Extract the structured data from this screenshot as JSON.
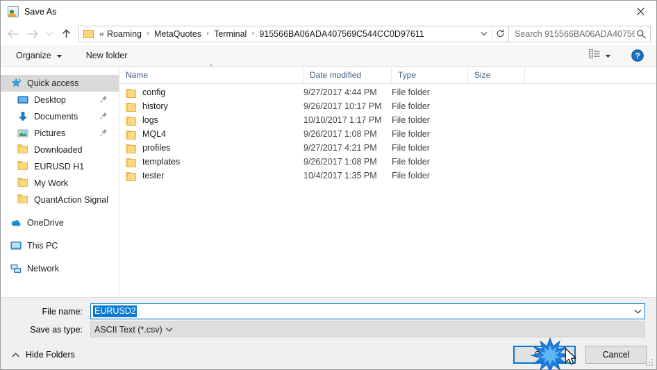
{
  "window": {
    "title": "Save As",
    "icon": "save-as-app-icon",
    "close_label": "✕"
  },
  "nav": {
    "back": "back-arrow",
    "forward": "forward-arrow",
    "recent": "recent-locations-chevron",
    "up": "up-arrow",
    "back_enabled": false,
    "forward_enabled": false,
    "up_enabled": true
  },
  "address": {
    "folder_icon": "folder-icon",
    "prefix": "«",
    "crumbs": [
      "Roaming",
      "MetaQuotes",
      "Terminal",
      "915566BA06ADA407569C544CC0D97611"
    ],
    "separator": "›",
    "dropdown_icon": "chevron-down-icon",
    "refresh_icon": "refresh-icon"
  },
  "search": {
    "placeholder": "Search 915566BA06ADA40756...",
    "value": "",
    "icon": "search-icon"
  },
  "toolbar": {
    "organize_label": "Organize",
    "organize_caret": "▾",
    "new_folder_label": "New folder",
    "view_icon": "list-view-icon",
    "view_caret": "▾",
    "help_icon": "help-icon",
    "help_label": "?"
  },
  "sidebar": {
    "items": [
      {
        "label": "Quick access",
        "icon": "star-pin-icon",
        "level": "top",
        "selected": true,
        "pinned": false
      },
      {
        "label": "Desktop",
        "icon": "desktop-icon",
        "level": "lvl0",
        "selected": false,
        "pinned": true
      },
      {
        "label": "Documents",
        "icon": "documents-icon",
        "level": "lvl0",
        "selected": false,
        "pinned": true
      },
      {
        "label": "Pictures",
        "icon": "pictures-icon",
        "level": "lvl0",
        "selected": false,
        "pinned": true
      },
      {
        "label": "Downloaded",
        "icon": "folder-icon",
        "level": "lvl0",
        "selected": false,
        "pinned": false
      },
      {
        "label": "EURUSD H1",
        "icon": "folder-icon",
        "level": "lvl0",
        "selected": false,
        "pinned": false
      },
      {
        "label": "My Work",
        "icon": "folder-icon",
        "level": "lvl0",
        "selected": false,
        "pinned": false
      },
      {
        "label": "QuantAction Signal",
        "icon": "folder-icon",
        "level": "lvl0",
        "selected": false,
        "pinned": false
      },
      {
        "label": "OneDrive",
        "icon": "onedrive-icon",
        "level": "top",
        "selected": false,
        "pinned": false
      },
      {
        "label": "This PC",
        "icon": "this-pc-icon",
        "level": "top",
        "selected": false,
        "pinned": false
      },
      {
        "label": "Network",
        "icon": "network-icon",
        "level": "top",
        "selected": false,
        "pinned": false
      }
    ]
  },
  "filelist": {
    "sort_indicator": "˄",
    "columns": [
      {
        "key": "name",
        "label": "Name"
      },
      {
        "key": "date",
        "label": "Date modified"
      },
      {
        "key": "type",
        "label": "Type"
      },
      {
        "key": "size",
        "label": "Size"
      }
    ],
    "rows": [
      {
        "name": "config",
        "date": "9/27/2017 4:44 PM",
        "type": "File folder",
        "size": "",
        "icon": "folder-icon"
      },
      {
        "name": "history",
        "date": "9/26/2017 10:17 PM",
        "type": "File folder",
        "size": "",
        "icon": "folder-icon"
      },
      {
        "name": "logs",
        "date": "10/10/2017 1:17 PM",
        "type": "File folder",
        "size": "",
        "icon": "folder-icon"
      },
      {
        "name": "MQL4",
        "date": "9/26/2017 1:08 PM",
        "type": "File folder",
        "size": "",
        "icon": "folder-icon"
      },
      {
        "name": "profiles",
        "date": "9/27/2017 4:21 PM",
        "type": "File folder",
        "size": "",
        "icon": "folder-icon"
      },
      {
        "name": "templates",
        "date": "9/26/2017 1:08 PM",
        "type": "File folder",
        "size": "",
        "icon": "folder-icon"
      },
      {
        "name": "tester",
        "date": "10/4/2017 1:35 PM",
        "type": "File folder",
        "size": "",
        "icon": "folder-icon"
      }
    ]
  },
  "form": {
    "filename_label": "File name:",
    "filename_value": "EURUSD2",
    "filename_selected": true,
    "filetype_label": "Save as type:",
    "filetype_value": "ASCII Text (*.csv)",
    "dropdown_icon": "chevron-down-icon"
  },
  "footer": {
    "hide_folders_label": "Hide Folders",
    "hide_folders_caret": "˄",
    "save_label": "Save",
    "cancel_label": "Cancel",
    "save_is_default": true,
    "resize_grip": "resize-grip"
  },
  "colors": {
    "accent": "#0078d7",
    "selection": "#0a7ad1",
    "sidebar_selected": "#d9d9d9",
    "chrome": "#f0f0f0",
    "folder_yellow": "#fcd97f",
    "header_text": "#3d5a80"
  },
  "pointer": {
    "click_effect": "click-burst",
    "cursor": "mouse-cursor",
    "target": "save-button"
  }
}
